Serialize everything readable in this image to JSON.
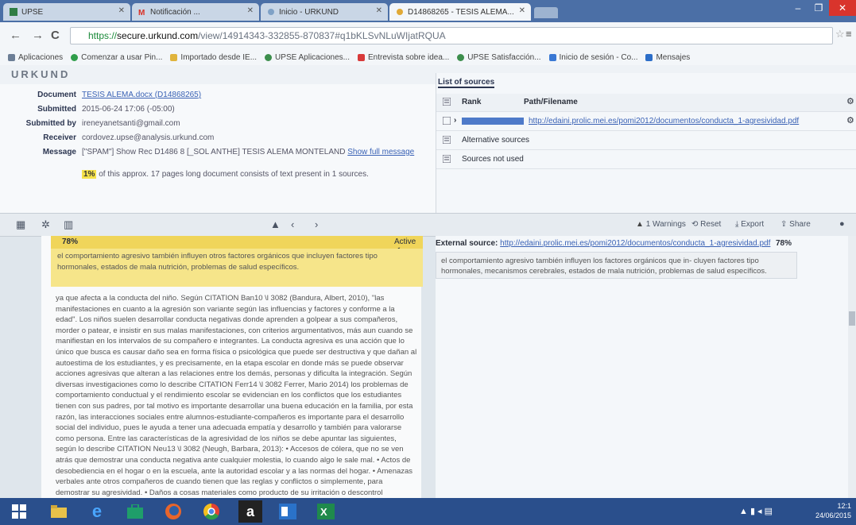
{
  "browser": {
    "tabs": [
      {
        "label": "UPSE"
      },
      {
        "label": "Notificación ... "
      },
      {
        "label": "Inicio - URKUND"
      },
      {
        "label": "D14868265 - TESIS ALEMA..."
      }
    ],
    "url": {
      "scheme": "https://",
      "host": "secure.urkund.com",
      "path": "/view/14914343-332855-870837#q1bKLSvNLuWIjatRQUA"
    },
    "bookmarks": [
      {
        "label": "Aplicaciones",
        "color": "#6c7e96"
      },
      {
        "label": "Comenzar a usar Pin...",
        "color": "#2f9e4a"
      },
      {
        "label": "Importado desde IE...",
        "color": "#e0b43c"
      },
      {
        "label": "UPSE Aplicaciones...",
        "color": "#3c8e4c"
      },
      {
        "label": "Entrevista sobre idea...",
        "color": "#d83a3a"
      },
      {
        "label": "UPSE Satisfacción...",
        "color": "#3c8e4c"
      },
      {
        "label": "Inicio de sesión - Co...",
        "color": "#3a78d4"
      },
      {
        "label": "Mensajes",
        "color": "#2c6ec8"
      }
    ]
  },
  "app": {
    "logo": "URKUND",
    "meta": [
      {
        "label": "Document",
        "value": "TESIS ALEMA.docx (D14868265)",
        "link": true
      },
      {
        "label": "Submitted",
        "value": "2015-06-24 17:06 (-05:00)",
        "link": false
      },
      {
        "label": "Submitted by",
        "value": "ireneyanetsanti@gmail.com",
        "link": false
      },
      {
        "label": "Receiver",
        "value": "cordovez.upse@analysis.urkund.com",
        "link": false
      },
      {
        "label": "Message",
        "value": "[\"SPAM\"] Show Rec D1486 8 [_SOL ANTHE] TESIS ALEMA MONTELAND",
        "link": false,
        "extra": "Show full message"
      }
    ],
    "summary_pct": "1%",
    "summary_text": "of this approx. 17 pages long document consists of text present in 1 sources.",
    "sources_title": "List of sources",
    "sources_cols": {
      "rank": "Rank",
      "path": "Path/Filename"
    },
    "sources": [
      {
        "path": "http://edaini.prolic.mei.es/pomi2012/documentos/conducta_1-agresividad.pdf"
      },
      {
        "label": "Alternative sources"
      },
      {
        "label": "Sources not used"
      }
    ]
  },
  "midbar": {
    "warnings": "1 Warnings",
    "reset": "Reset",
    "export": "Export",
    "share": "Share"
  },
  "doc": {
    "match_pct": "78%",
    "match_state": "Active",
    "match_text": "el comportamiento agresivo también influyen otros factores orgánicos que incluyen factores tipo hormonales, estados de mala nutrición, problemas de salud específicos.",
    "body": "ya que afecta a la conducta del niño. Según CITATION Ban10 \\l 3082 (Bandura, Albert, 2010), \"las manifestaciones en cuanto a la agresión son variante según las influencias y factores y conforme a la edad\". Los niños suelen desarrollar conducta negativas donde aprenden a golpear a sus compañeros, morder o patear, e insistir en sus malas manifestaciones, con criterios argumentativos, más aun cuando se manifiestan en los intervalos de su compañero e integrantes. La conducta agresiva es una acción que lo único que busca es causar daño sea en forma física o psicológica que puede ser destructiva y que dañan al autoestima de los estudiantes, y es precisamente, en la etapa escolar en donde más se puede observar acciones agresivas que alteran a las relaciones entre los demás, personas y dificulta la integración. Según diversas investigaciones como lo describe CITATION Ferr14 \\l 3082 Ferrer, Mario 2014) los problemas de comportamiento conductual y el rendimiento escolar se evidencian en los conflictos que los estudiantes tienen con sus padres, por tal motivo es importante desarrollar una buena educación en la familia, por esta razón, las interacciones sociales entre alumnos-estudiante-compañeros es importante para el desarrollo social del individuo, pues le ayuda a tener una adecuada empatía y desarrollo y también para valorarse como persona. Entre las características de la agresividad de los niños se debe apuntar las siguientes, según lo describe CITATION Neu13 \\l 3082 (Neugh, Barbara, 2013): • Accesos de cólera, que no se ven atrás que demostrar una conducta negativa ante cualquier molestia, lo cuando algo le sale mal. • Actos de desobediencia en el hogar o en la escuela, ante la autoridad escolar y a las normas del hogar. • Amenazas verbales ante otros compañeros de cuando tienen que las reglas y conflictos o simplemente, para demostrar su agresividad. • Daños a cosas materiales como producto de su irritación o descontrol conductual. • Deterioro o falta de los padres y de sus propias cosas.",
    "ext_label": "External source:",
    "ext_url": "http://edaini.prolic.mei.es/pomi2012/documentos/conducta_1-agresividad.pdf",
    "ext_pct": "78%",
    "ext_text": "el comportamiento agresivo también influyen los factores orgánicos que in- cluyen factores tipo hormonales, mecanismos cerebrales, estados de mala nutrición, problemas de salud específicos."
  },
  "taskbar": {
    "clock_time": "12:1",
    "clock_date": "24/06/2015"
  },
  "colors": {
    "highlight": "#f6e58a",
    "highlight_head": "#f0d55a",
    "taskbar": "#2a4f8c",
    "tabstrip": "#4b6fa6"
  }
}
